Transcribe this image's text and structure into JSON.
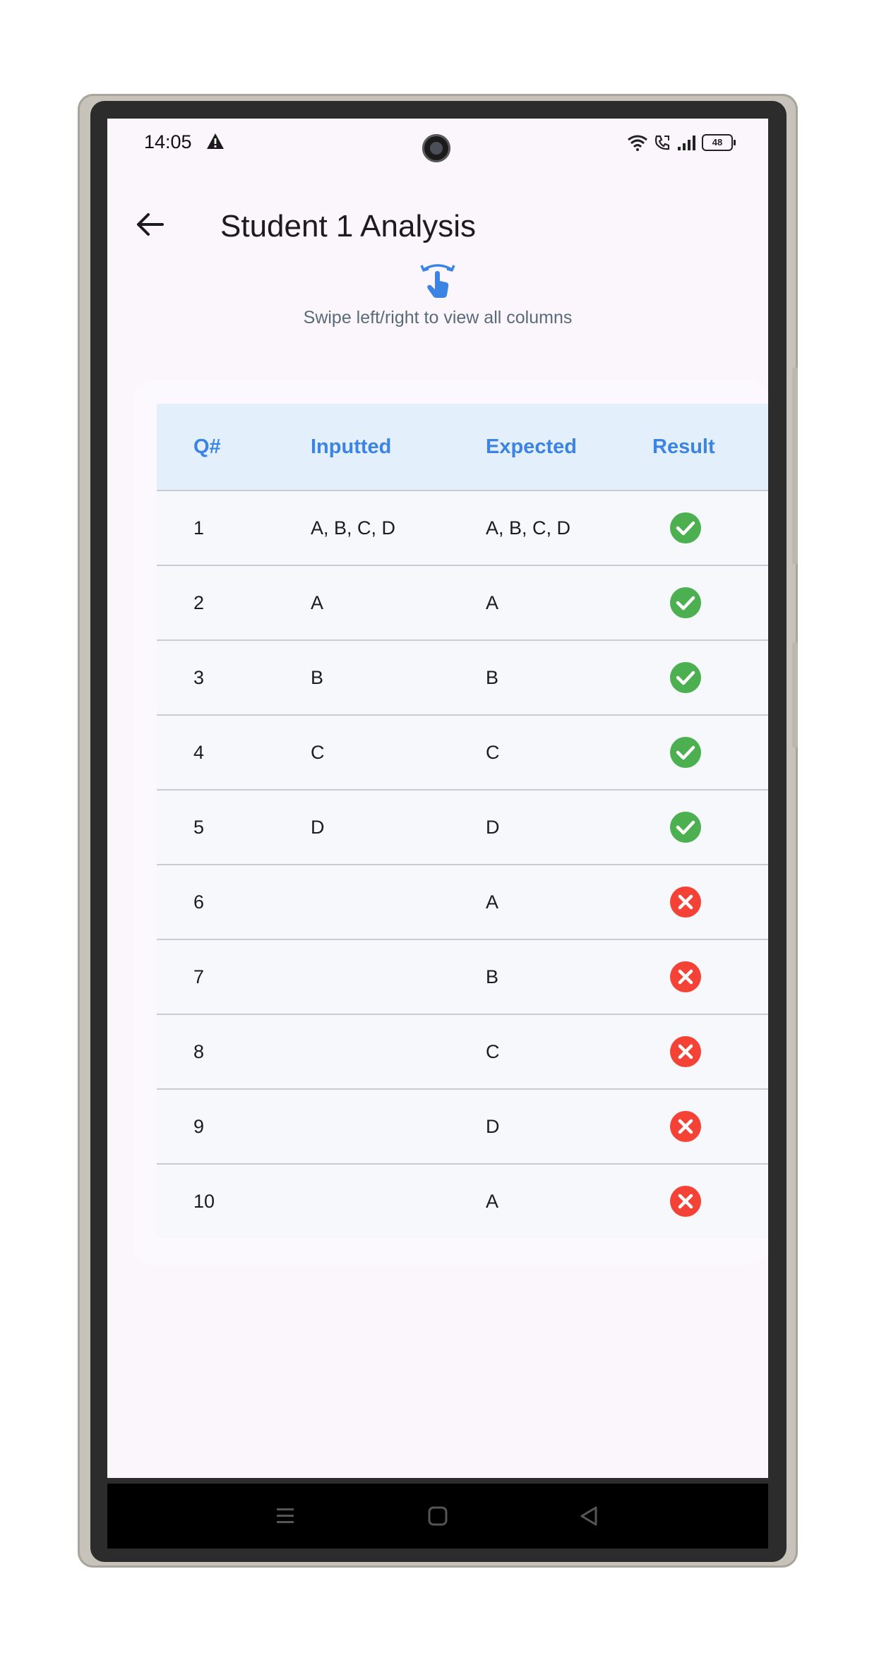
{
  "status_bar": {
    "time": "14:05",
    "battery": "48",
    "icons": [
      "warning-icon",
      "wifi-icon",
      "call-icon",
      "signal-icon",
      "battery-icon"
    ]
  },
  "app_bar": {
    "title": "Student 1 Analysis",
    "back_icon": "arrow-left-icon"
  },
  "hint": {
    "icon": "swipe-icon",
    "text": "Swipe left/right to view all columns"
  },
  "table": {
    "headers": [
      "Q#",
      "Inputted",
      "Expected",
      "Result"
    ],
    "rows": [
      {
        "q": "1",
        "inputted": "A, B, C, D",
        "expected": "A, B, C, D",
        "result": "correct"
      },
      {
        "q": "2",
        "inputted": "A",
        "expected": "A",
        "result": "correct"
      },
      {
        "q": "3",
        "inputted": "B",
        "expected": "B",
        "result": "correct"
      },
      {
        "q": "4",
        "inputted": "C",
        "expected": "C",
        "result": "correct"
      },
      {
        "q": "5",
        "inputted": "D",
        "expected": "D",
        "result": "correct"
      },
      {
        "q": "6",
        "inputted": "",
        "expected": "A",
        "result": "incorrect"
      },
      {
        "q": "7",
        "inputted": "",
        "expected": "B",
        "result": "incorrect"
      },
      {
        "q": "8",
        "inputted": "",
        "expected": "C",
        "result": "incorrect"
      },
      {
        "q": "9",
        "inputted": "",
        "expected": "D",
        "result": "incorrect"
      },
      {
        "q": "10",
        "inputted": "",
        "expected": "A",
        "result": "incorrect"
      }
    ]
  },
  "colors": {
    "accent": "#3c84e3",
    "correct": "#4caf50",
    "incorrect": "#f44336",
    "header_bg": "#e3f0fc",
    "screen_bg": "#fbf6fc"
  },
  "nav_bar": {
    "icons": [
      "recents-icon",
      "home-icon",
      "back-icon"
    ]
  }
}
